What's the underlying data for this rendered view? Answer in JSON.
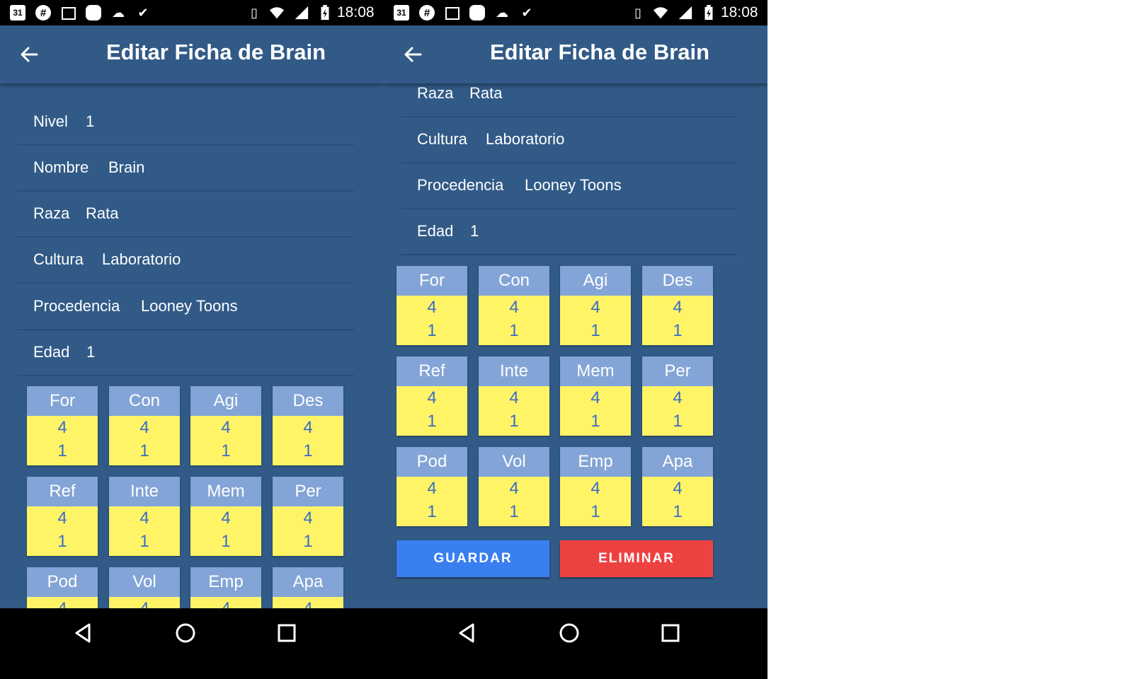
{
  "status_bar": {
    "time": "18:08",
    "calendar_day": "31"
  },
  "app_bar": {
    "title": "Editar Ficha de Brain"
  },
  "fields": [
    {
      "label": "Nivel",
      "value": "1"
    },
    {
      "label": "Nombre",
      "value": "Brain"
    },
    {
      "label": "Raza",
      "value": "Rata"
    },
    {
      "label": "Cultura",
      "value": "Laboratorio"
    },
    {
      "label": "Procedencia",
      "value": "Looney Toons"
    },
    {
      "label": "Edad",
      "value": "1"
    }
  ],
  "stats": [
    {
      "name": "For",
      "value": "4",
      "mod": "1"
    },
    {
      "name": "Con",
      "value": "4",
      "mod": "1"
    },
    {
      "name": "Agi",
      "value": "4",
      "mod": "1"
    },
    {
      "name": "Des",
      "value": "4",
      "mod": "1"
    },
    {
      "name": "Ref",
      "value": "4",
      "mod": "1"
    },
    {
      "name": "Inte",
      "value": "4",
      "mod": "1"
    },
    {
      "name": "Mem",
      "value": "4",
      "mod": "1"
    },
    {
      "name": "Per",
      "value": "4",
      "mod": "1"
    },
    {
      "name": "Pod",
      "value": "4",
      "mod": "1"
    },
    {
      "name": "Vol",
      "value": "4",
      "mod": "1"
    },
    {
      "name": "Emp",
      "value": "4",
      "mod": "1"
    },
    {
      "name": "Apa",
      "value": "4",
      "mod": "1"
    }
  ],
  "buttons": {
    "save": "GUARDAR",
    "delete": "ELIMINAR"
  },
  "colors": {
    "primary": "#315a87",
    "stat_header": "#83a4d6",
    "stat_body": "#fff466",
    "stat_text": "#3b6cc7",
    "save_button": "#3a7ff0",
    "delete_button": "#ee4242"
  },
  "icons": {
    "back": "arrow-left",
    "nav_back": "triangle-back",
    "nav_home": "circle-home",
    "nav_recent": "square-recents"
  }
}
